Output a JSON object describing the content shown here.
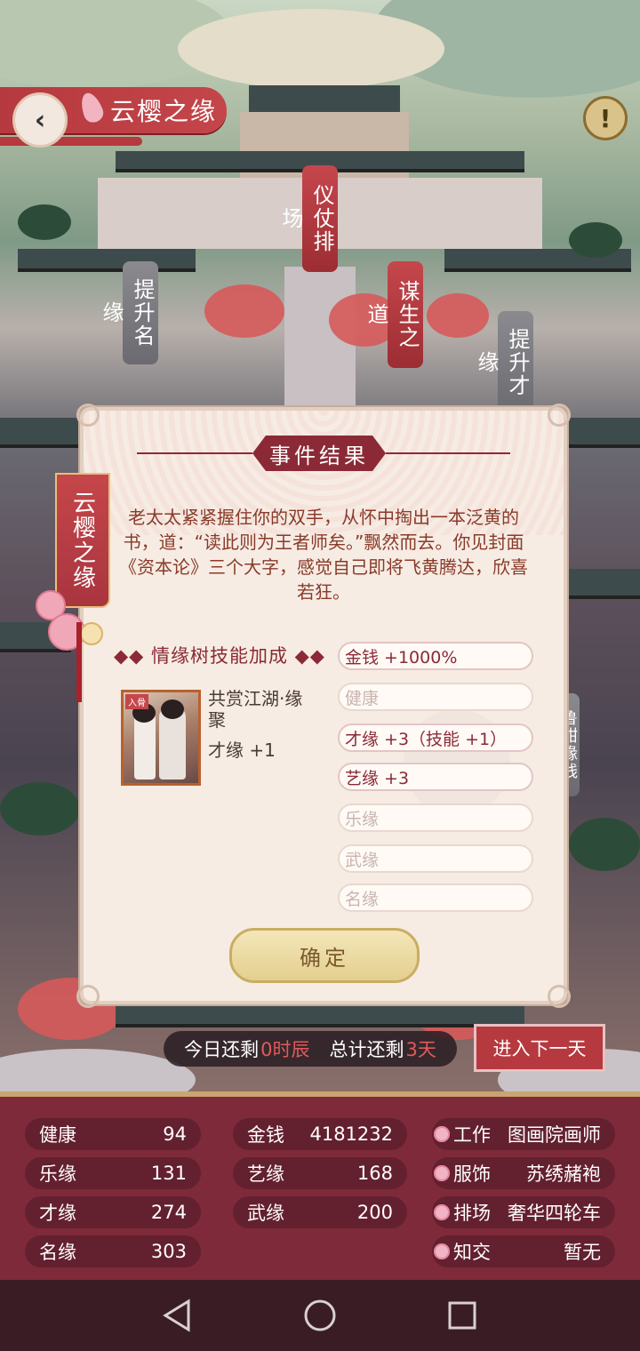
{
  "header": {
    "title": "云樱之缘",
    "alert_glyph": "!"
  },
  "map_signs": {
    "yizhang": "仪仗排场",
    "tisheng_mingyuan": "提升名缘",
    "mousheng": "谋生之道",
    "tisheng_caiyuan": "提升才缘",
    "right_partial": "鲁甜缘线"
  },
  "modal": {
    "title": "事件结果",
    "side_banner": "云樱之缘",
    "story": "老太太紧紧握住你的双手，从怀中掏出一本泛黄的书，道：“读此则为王者师矣。”飘然而去。你见封面《资本论》三个大字，感觉自己即将飞黄腾达，欣喜若狂。",
    "bonus_label": "◆◆ 情缘树技能加成 ◆◆",
    "card": {
      "tag": "入骨",
      "name": "共赏江湖·缘聚",
      "bonus": "才缘 +1"
    },
    "stats": [
      {
        "text": "金钱 +1000%",
        "active": true
      },
      {
        "text": "健康",
        "active": false
      },
      {
        "text": "才缘 +3（技能 +1）",
        "active": true
      },
      {
        "text": "艺缘 +3",
        "active": true
      },
      {
        "text": "乐缘",
        "active": false
      },
      {
        "text": "武缘",
        "active": false
      },
      {
        "text": "名缘",
        "active": false
      }
    ],
    "confirm": "确定"
  },
  "day_bar": {
    "prefix": "今日还剩",
    "hours": "0时辰",
    "middle": "总计还剩",
    "days": "3天"
  },
  "next_day_button": "进入下一天",
  "player_stats": {
    "col1": [
      {
        "label": "健康",
        "value": "94"
      },
      {
        "label": "乐缘",
        "value": "131"
      },
      {
        "label": "才缘",
        "value": "274"
      },
      {
        "label": "名缘",
        "value": "303"
      }
    ],
    "col2": [
      {
        "label": "金钱",
        "value": "4181232"
      },
      {
        "label": "艺缘",
        "value": "168"
      },
      {
        "label": "武缘",
        "value": "200"
      }
    ],
    "col3": [
      {
        "label": "工作",
        "value": "图画院画师"
      },
      {
        "label": "服饰",
        "value": "苏绣赭袍"
      },
      {
        "label": "排场",
        "value": "奢华四轮车"
      },
      {
        "label": "知交",
        "value": "暂无"
      }
    ]
  },
  "icons": {
    "back": "chevron-left-icon",
    "alert": "exclamation-icon",
    "flower": "blossom-icon",
    "nav_back": "triangle-back-icon",
    "nav_home": "circle-home-icon",
    "nav_recent": "square-recent-icon"
  },
  "colors": {
    "accent_red": "#b6393f",
    "panel_maroon": "#7e2a3a",
    "highlight_red": "#e05a5a",
    "gold": "#c9ad62"
  }
}
